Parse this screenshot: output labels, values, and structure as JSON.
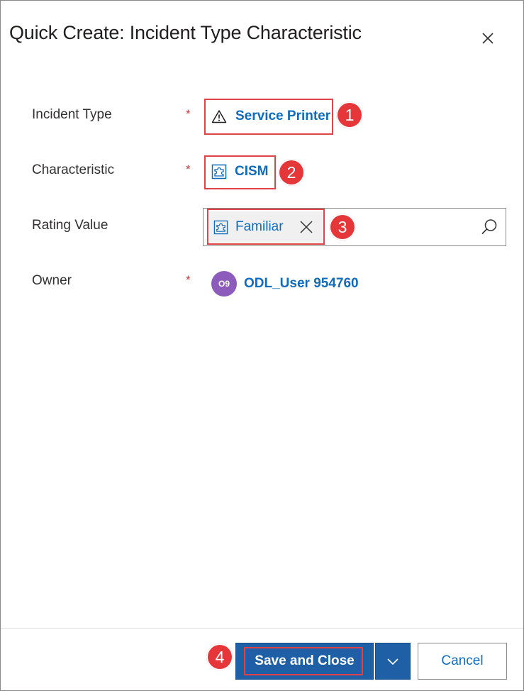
{
  "dialog": {
    "title": "Quick Create: Incident Type Characteristic",
    "close_icon": "close-icon"
  },
  "fields": {
    "incident_type": {
      "label": "Incident Type",
      "required_mark": "*",
      "value": "Service Printer",
      "icon": "warning-triangle-icon"
    },
    "characteristic": {
      "label": "Characteristic",
      "required_mark": "*",
      "value": "CISM",
      "icon": "puzzle-icon"
    },
    "rating_value": {
      "label": "Rating Value",
      "value": "Familiar",
      "icon": "puzzle-icon",
      "clear_icon": "close-icon",
      "search_icon": "search-icon"
    },
    "owner": {
      "label": "Owner",
      "required_mark": "*",
      "avatar_initials": "O9",
      "value": "ODL_User 954760"
    }
  },
  "callouts": [
    "1",
    "2",
    "3",
    "4"
  ],
  "footer": {
    "save_label": "Save and Close",
    "more_icon": "chevron-down-icon",
    "cancel_label": "Cancel"
  },
  "colors": {
    "link": "#0f6cbd",
    "primary_button": "#1f5fa6",
    "required": "#d13438",
    "callout": "#e5363a",
    "avatar": "#8d5bbb"
  }
}
